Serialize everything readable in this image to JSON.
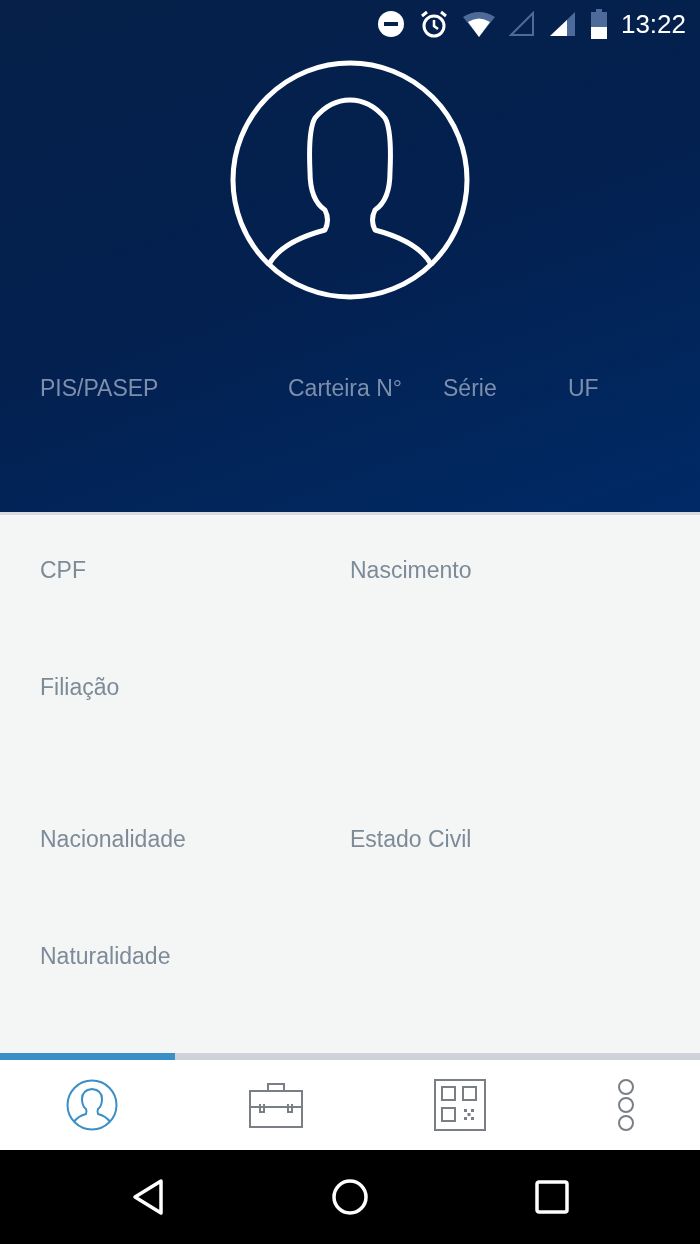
{
  "status_bar": {
    "time": "13:22"
  },
  "header": {
    "labels": [
      "PIS/PASEP",
      "Carteira N°",
      "Série",
      "UF"
    ]
  },
  "fields": [
    {
      "labels": [
        "CPF",
        "Nascimento"
      ]
    },
    {
      "labels": [
        "Filiação"
      ]
    },
    {
      "labels": [
        "Nacionalidade",
        "Estado Civil"
      ]
    },
    {
      "labels": [
        "Naturalidade"
      ]
    }
  ],
  "tabs": [
    {
      "kind": "profile",
      "selected": true
    },
    {
      "kind": "briefcase",
      "selected": false
    },
    {
      "kind": "qr",
      "selected": false
    },
    {
      "kind": "more",
      "selected": false
    }
  ]
}
